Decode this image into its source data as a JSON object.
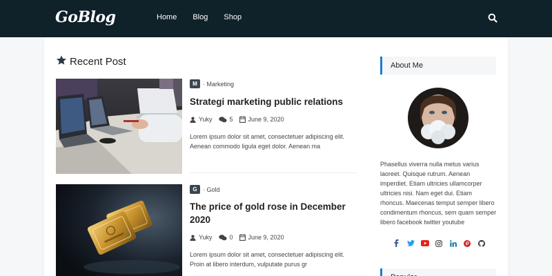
{
  "header": {
    "logo": "GoBlog",
    "nav": [
      {
        "label": "Home"
      },
      {
        "label": "Blog"
      },
      {
        "label": "Shop"
      }
    ],
    "search_icon": "search-icon"
  },
  "main": {
    "section_title": "Recent Post",
    "section_icon": "star-icon",
    "posts": [
      {
        "category_initial": "M",
        "category": "Marketing",
        "title": "Strategi marketing public relations",
        "author": "Yuky",
        "comments": "5",
        "date": "June 9, 2020",
        "excerpt": "Lorem ipsum dolor sit amet, consectetuer adipiscing elit. Aenean commodo ligula eget dolor. Aenean ma"
      },
      {
        "category_initial": "G",
        "category": "Gold",
        "title": "The price of gold rose in December 2020",
        "author": "Yuky",
        "comments": "0",
        "date": "June 9, 2020",
        "excerpt": "Lorem ipsum dolor sit amet, consectetuer adipiscing elit. Proin at libero interdum, vulputate purus gr"
      }
    ]
  },
  "sidebar": {
    "about_title": "About Me",
    "about_text": "Phasellus viverra nulla metus varius laoreet. Quisque rutrum. Aenean imperdiet. Etiam ultricies ullamcorper ultricies nisi. Nam eget dui. Etiam rhoncus. Maecenas temput semper libero condimentum rhoncus, sem quam semper libero facebook twitter youtube",
    "socials": [
      {
        "icon": "facebook-icon",
        "color": "#3b5998"
      },
      {
        "icon": "twitter-icon",
        "color": "#1da1f2"
      },
      {
        "icon": "youtube-icon",
        "color": "#e62117"
      },
      {
        "icon": "instagram-icon",
        "color": "#555555"
      },
      {
        "icon": "linkedin-icon",
        "color": "#0e76a8"
      },
      {
        "icon": "pinterest-icon",
        "color": "#cb2027"
      },
      {
        "icon": "github-icon",
        "color": "#333333"
      }
    ],
    "next_widget_title": "Popular"
  },
  "colors": {
    "header_bg": "#0f2129",
    "accent": "#1c7bd6",
    "badge_bg": "#3a4650"
  }
}
